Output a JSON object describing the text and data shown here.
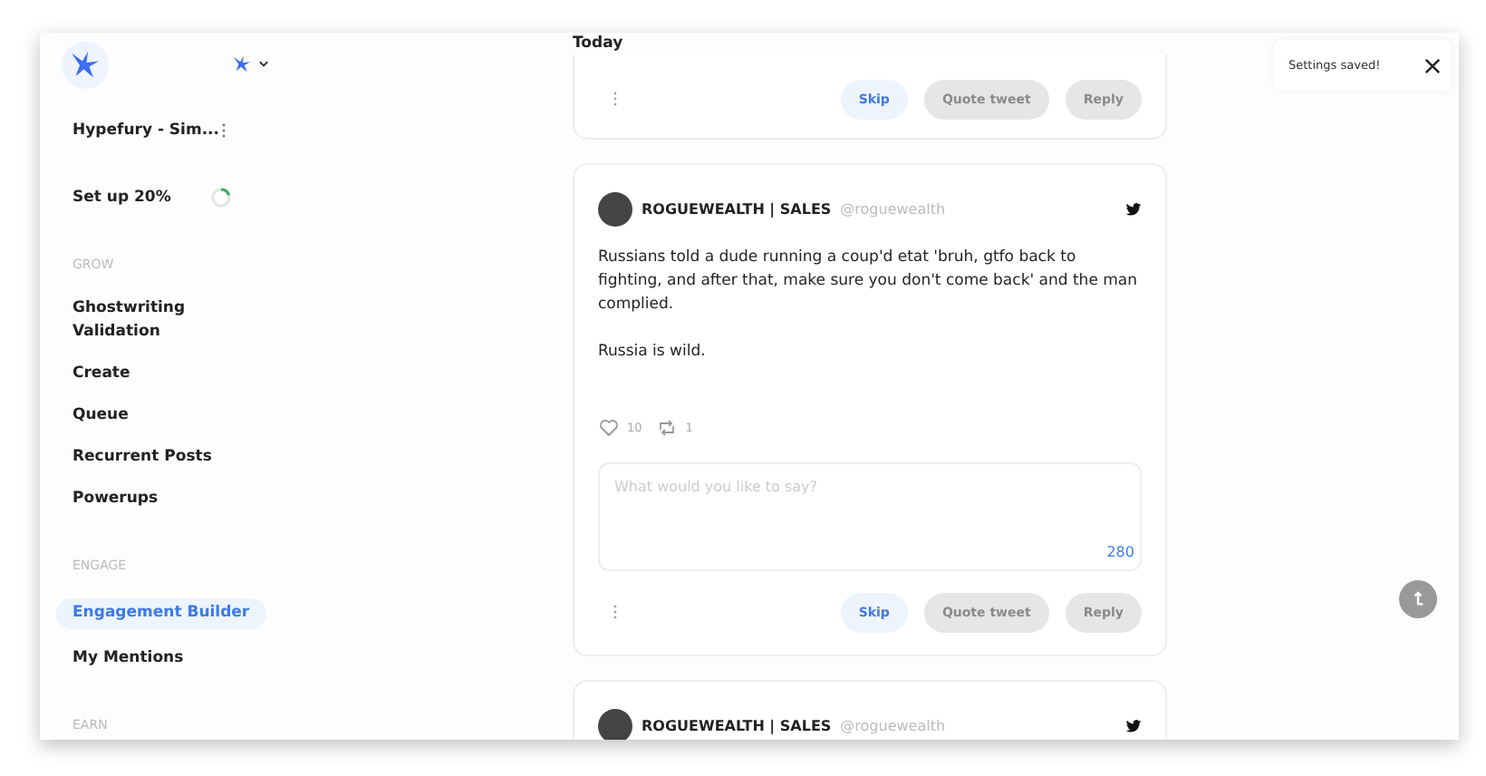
{
  "sidebar": {
    "workspace": {
      "name": "Hypefury - Sim..."
    },
    "setup": {
      "label": "Set up 20%",
      "level": 0.2
    },
    "sections": [
      {
        "title": "GROW",
        "items": [
          {
            "label": "Ghostwriting Validation",
            "selected": false
          },
          {
            "label": "Create",
            "selected": false
          },
          {
            "label": "Queue",
            "selected": false
          },
          {
            "label": "Recurrent Posts",
            "selected": false
          },
          {
            "label": "Powerups",
            "selected": false
          }
        ]
      },
      {
        "title": "ENGAGE",
        "items": [
          {
            "label": "Engagement Builder",
            "selected": true
          },
          {
            "label": "My Mentions",
            "selected": false
          }
        ]
      },
      {
        "title": "EARN"
      }
    ]
  },
  "feed": {
    "heading": "Today",
    "tweets": [
      {
        "actions": [
          {
            "label": "Skip",
            "disabled": false
          },
          {
            "label": "Quote tweet",
            "disabled": true
          },
          {
            "label": "Reply",
            "disabled": true
          }
        ]
      },
      {
        "author": "ROGUEWEALTH | SALES",
        "handle": "@roguewealth",
        "paragraphs": [
          "Russians told a dude running a coup'd etat 'bruh, gtfo back to fighting, and after that, make sure you don't come back' and the man complied.",
          "Russia is wild."
        ],
        "likes": "10",
        "retweets": "1",
        "reply": {
          "placeholder": "What would you like to say?",
          "count": "280"
        },
        "actions": [
          {
            "label": "Skip",
            "disabled": false
          },
          {
            "label": "Quote tweet",
            "disabled": true
          },
          {
            "label": "Reply",
            "disabled": true
          }
        ]
      },
      {
        "author": "ROGUEWEALTH | SALES",
        "handle": "@roguewealth"
      }
    ]
  },
  "toast": {
    "message": "Settings saved!"
  }
}
